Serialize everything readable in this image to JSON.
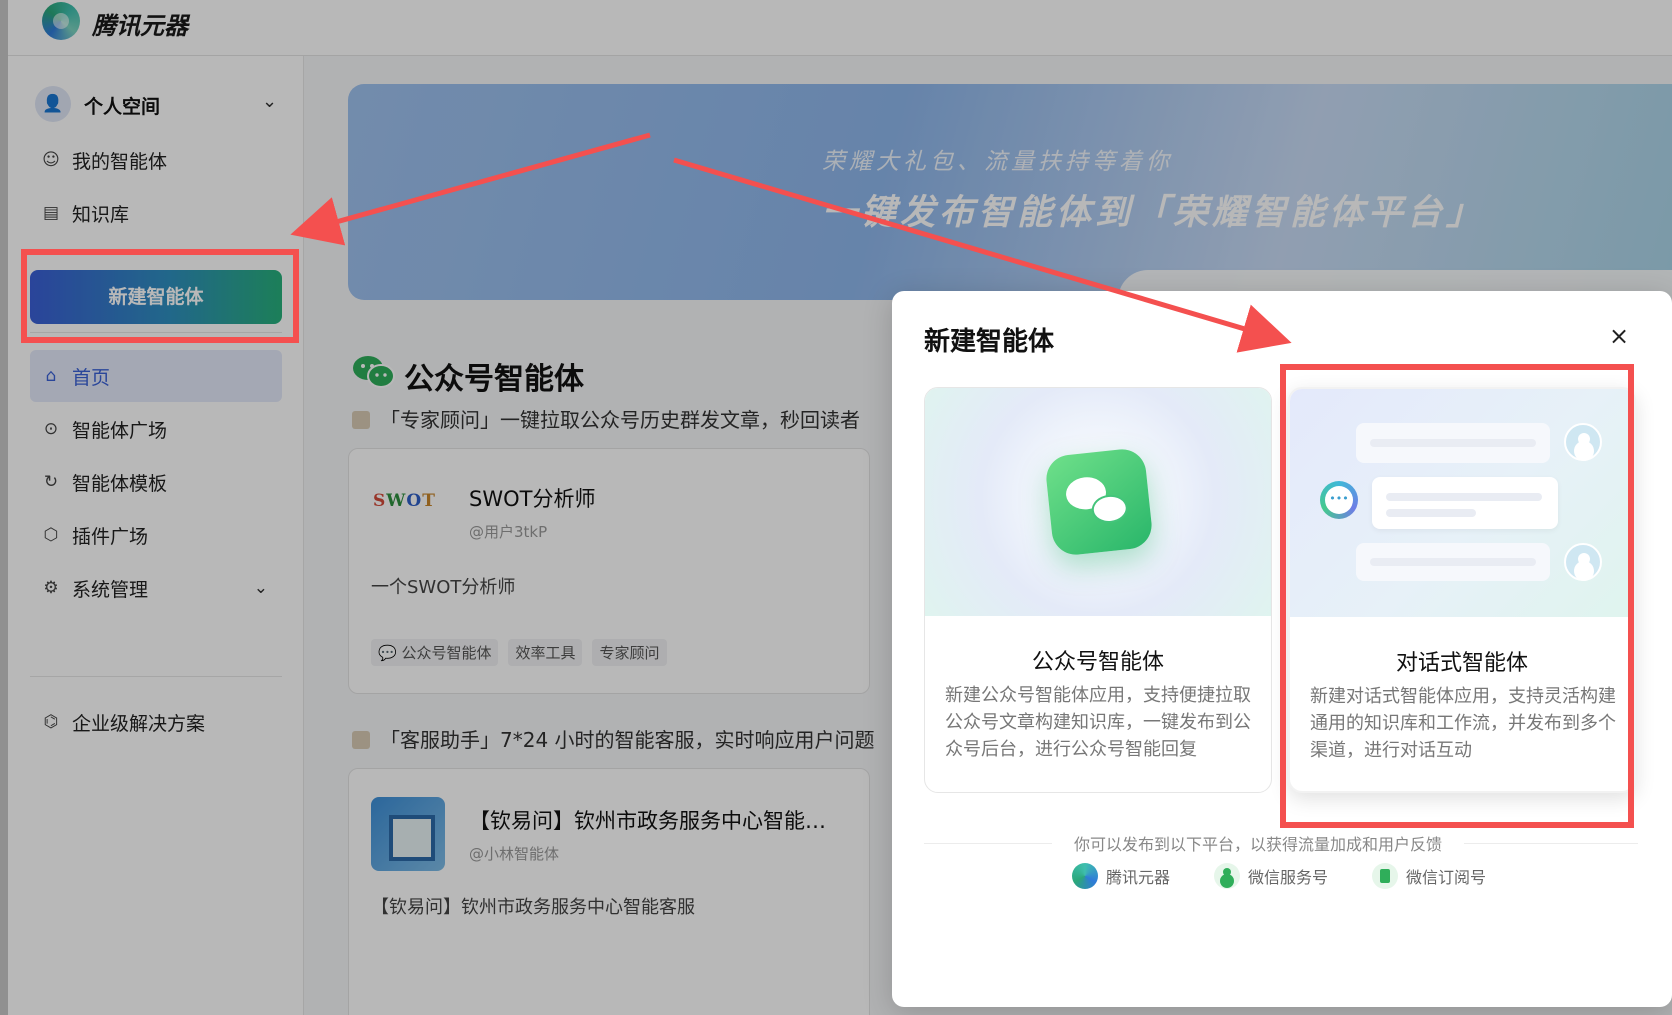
{
  "app": {
    "brand": "腾讯元器"
  },
  "sidebar": {
    "space_label": "个人空间",
    "items_top": [
      {
        "label": "我的智能体",
        "icon": "bot-icon"
      },
      {
        "label": "知识库",
        "icon": "document-icon"
      }
    ],
    "new_agent_button": "新建智能体",
    "items_main": [
      {
        "label": "首页",
        "icon": "home-icon",
        "active": true
      },
      {
        "label": "智能体广场",
        "icon": "robot-face-icon"
      },
      {
        "label": "智能体模板",
        "icon": "template-icon"
      },
      {
        "label": "插件广场",
        "icon": "cube-icon"
      },
      {
        "label": "系统管理",
        "icon": "gear-icon"
      }
    ],
    "enterprise": "企业级解决方案"
  },
  "banner": {
    "subtitle": "荣耀大礼包、流量扶持等着你",
    "title": "一键发布智能体到「荣耀智能体平台」"
  },
  "section": {
    "title": "公众号智能体",
    "desc1": "「专家顾问」一键拉取公众号历史群发文章，秒回读者",
    "desc2": "「客服助手」7*24 小时的智能客服，实时响应用户问题"
  },
  "cards": [
    {
      "logo_letters": [
        "S",
        "W",
        "O",
        "T"
      ],
      "name": "SWOT分析师",
      "author": "@用户3tkP",
      "desc": "一个SWOT分析师",
      "tags": [
        "公众号智能体",
        "效率工具",
        "专家顾问"
      ]
    },
    {
      "name": "【钦易问】钦州市政务服务中心智能…",
      "author": "@小林智能体",
      "desc": "【钦易问】钦州市政务服务中心智能客服"
    }
  ],
  "modal": {
    "title": "新建智能体",
    "close": "×",
    "options": [
      {
        "name": "公众号智能体",
        "desc": "新建公众号智能体应用，支持便捷拉取公众号文章构建知识库，一键发布到公众号后台，进行公众号智能回复"
      },
      {
        "name": "对话式智能体",
        "desc": "新建对话式智能体应用，支持灵活构建通用的知识库和工作流，并发布到多个渠道，进行对话互动"
      }
    ],
    "publish_hint": "你可以发布到以下平台，以获得流量加成和用户反馈",
    "platforms": [
      "腾讯元器",
      "微信服务号",
      "微信订阅号"
    ]
  },
  "colors": {
    "accent": "#3b62d6",
    "annotation_red": "#f4504f",
    "wechat_green": "#2fae5a"
  }
}
